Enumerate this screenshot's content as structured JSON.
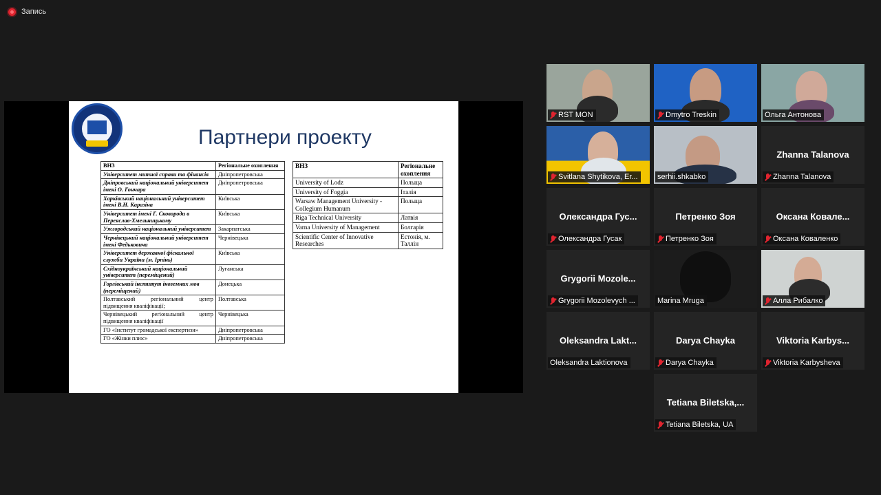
{
  "recording": {
    "label": "Запись"
  },
  "slide": {
    "title": "Партнери проекту",
    "table1": {
      "headers": [
        "ВНЗ",
        "Регіональне охоплення"
      ],
      "rows": [
        [
          "Університет митної справи та фінансів",
          "Дніпропетровська"
        ],
        [
          "Дніпровський національний університет імені О. Гончара",
          "Дніпропетровська"
        ],
        [
          "Харківський національний університет імені В.Н. Каразіна",
          "Київська"
        ],
        [
          "Університет імені Г. Сковороди в Переяслав-Хмельницькому",
          "Київська"
        ],
        [
          "Ужгородський національний університет",
          "Закарпатська"
        ],
        [
          "Чернівецький національний університет імені Федьковича",
          "Чернівецька"
        ],
        [
          "Університет державної фіскальної служби України (м. Ірпінь)",
          "Київська"
        ],
        [
          "Східноукраїнський національний університет (переміщений)",
          "Луганська"
        ],
        [
          "Горлівський інститут іноземних мов (переміщений)",
          "Донецька"
        ],
        [
          "Полтавський регіональний центр підвищення кваліфікації;",
          "Полтавська"
        ],
        [
          "Чернівецький регіональний центр підвищення кваліфікації",
          "Чернівецька"
        ],
        [
          "ГО «Інститут громадської експертизи»",
          "Дніпропетровська"
        ],
        [
          "ГО «Жінки плюс»",
          "Дніпропетровська"
        ]
      ]
    },
    "table2": {
      "headers": [
        "ВНЗ",
        "Регіональне охоплення"
      ],
      "rows": [
        [
          "University of Lodz",
          "Польща"
        ],
        [
          "University of Foggia",
          "Італія"
        ],
        [
          "Warsaw Management University - Collegium Humanum",
          "Польща"
        ],
        [
          "Riga Technical University",
          "Латвія"
        ],
        [
          "Varna University of Management",
          "Болгарія"
        ],
        [
          "Scientific Center of Innovative Researches",
          "Естонія, м. Таллін"
        ]
      ]
    }
  },
  "participants": [
    {
      "label": "RST MON",
      "muted": true,
      "video": true,
      "bg": "#9aa59c"
    },
    {
      "label": "Dmytro Treskin",
      "muted": true,
      "video": true,
      "bg": "#1f62c4"
    },
    {
      "label": "Ольга Антонова",
      "muted": false,
      "video": true,
      "bg": "#8aa6a4"
    },
    {
      "label": "Svitlana Shytikova, Er...",
      "muted": true,
      "video": true,
      "bg": "#2b5fa8"
    },
    {
      "label": "serhii.shkabko",
      "muted": false,
      "video": true,
      "bg": "#b8bfc6",
      "active": true
    },
    {
      "label": "Zhanna Talanova",
      "big": "Zhanna Talanova",
      "muted": true,
      "video": false
    },
    {
      "label": "Олександра Гусак",
      "big": "Олександра Гус...",
      "muted": true,
      "video": false
    },
    {
      "label": "Петренко Зоя",
      "big": "Петренко Зоя",
      "muted": true,
      "video": false
    },
    {
      "label": "Оксана Коваленко",
      "big": "Оксана Ковале...",
      "muted": true,
      "video": false
    },
    {
      "label": "Grygorii Mozolevych ...",
      "big": "Grygorii Mozole...",
      "muted": true,
      "video": false
    },
    {
      "label": "Marina Mruga",
      "muted": false,
      "video": true,
      "bg": "#1c1c1c"
    },
    {
      "label": "Алла Рибалко",
      "muted": true,
      "video": true,
      "bg": "#cfd3d2"
    },
    {
      "label": "Oleksandra Laktionova",
      "big": "Oleksandra Lakt...",
      "muted": false,
      "video": false
    },
    {
      "label": "Darya Chayka",
      "big": "Darya Chayka",
      "muted": true,
      "video": false
    },
    {
      "label": "Viktoria Karbysheva",
      "big": "Viktoria Karbys...",
      "muted": true,
      "video": false
    },
    {
      "label": "Tetiana Biletska, UA",
      "big": "Tetiana Biletska,...",
      "muted": true,
      "video": false
    }
  ]
}
